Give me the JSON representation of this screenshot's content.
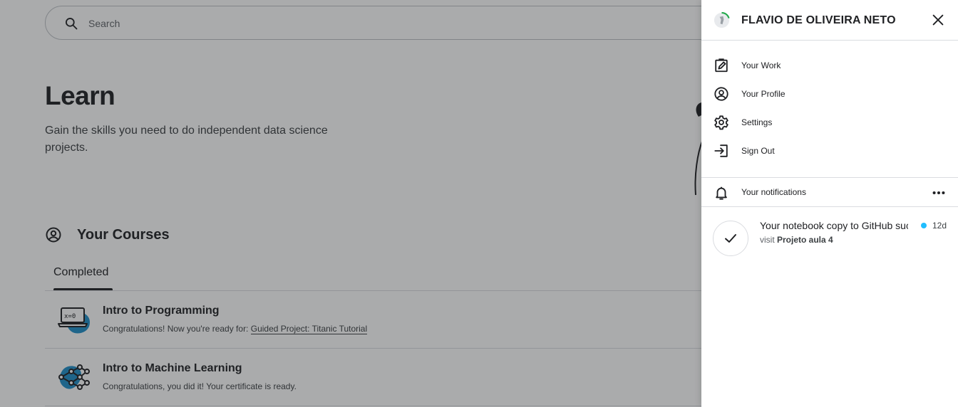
{
  "search": {
    "placeholder": "Search",
    "icon": "search-icon"
  },
  "hero": {
    "title": "Learn",
    "subtitle": "Gain the skills you need to do independent data science projects."
  },
  "courses_section": {
    "title": "Your Courses",
    "icon": "person-circle-icon",
    "tabs": [
      {
        "label": "Completed",
        "active": true
      }
    ],
    "items": [
      {
        "name": "Intro to Programming",
        "message": "Congratulations! Now you're ready for: ",
        "link": "Guided Project: Titanic Tutorial",
        "icon": "laptop-icon"
      },
      {
        "name": "Intro to Machine Learning",
        "message": "Congratulations, you did it! Your certificate is ready.",
        "link": "",
        "icon": "network-icon"
      }
    ]
  },
  "drawer": {
    "user_name": "FLAVIO DE OLIVEIRA NETO",
    "avatar_icon": "avatar",
    "close_icon": "close-icon",
    "menu": [
      {
        "label": "Your Work",
        "icon": "edit-note-icon"
      },
      {
        "label": "Your Profile",
        "icon": "person-circle-icon"
      },
      {
        "label": "Settings",
        "icon": "gear-icon"
      },
      {
        "label": "Sign Out",
        "icon": "sign-out-icon"
      }
    ],
    "notifications": {
      "header": "Your notifications",
      "header_icon": "bell-icon",
      "more_icon": "more-horizontal-icon",
      "items": [
        {
          "title": "Your notebook copy to GitHub succeeded",
          "detail_prefix": "visit ",
          "detail_bold": "Projeto aula 4",
          "age": "12d",
          "unread": true,
          "icon": "check-icon"
        }
      ]
    }
  },
  "colors": {
    "overlay": "#5f6062",
    "unread_dot": "#20beff",
    "course_blob": "#1f8fc9",
    "avatar_ring": "#20a84a"
  }
}
